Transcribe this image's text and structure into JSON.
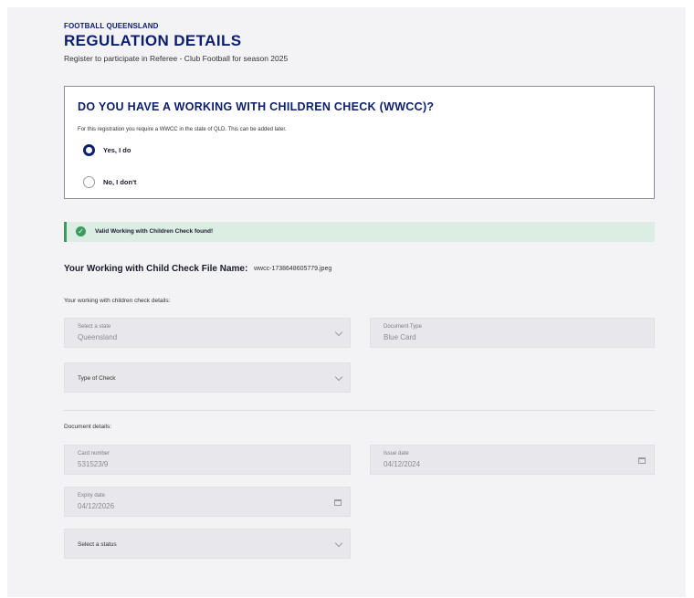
{
  "header": {
    "org": "FOOTBALL QUEENSLAND",
    "title": "REGULATION DETAILS",
    "subtitle": "Register to participate in Referee - Club Football for season 2025"
  },
  "wwcc_question": {
    "title": "DO YOU HAVE A WORKING WITH CHILDREN CHECK (WWCC)?",
    "description": "For this registration you require a WWCC in the state of QLD. This can be added later.",
    "options": [
      {
        "label": "Yes, I do",
        "selected": true
      },
      {
        "label": "No, I don't",
        "selected": false
      }
    ]
  },
  "banner": {
    "message": "Valid Working with Children Check found!",
    "color": "#3d9a5e"
  },
  "file": {
    "label": "Your Working with Child Check File Name:",
    "name": "wwcc-1738648605779.jpeg"
  },
  "wwcc_details": {
    "section_label": "Your working with children check details:",
    "state": {
      "label": "Select a state",
      "value": "Queensland"
    },
    "document_type": {
      "label": "Document Type",
      "value": "Blue Card"
    },
    "type_of_check": {
      "placeholder": "Type of Check"
    }
  },
  "document_details": {
    "section_label": "Document details:",
    "card_number": {
      "label": "Card number",
      "value": "531523/9"
    },
    "issue_date": {
      "label": "Issue date",
      "value": "04/12/2024"
    },
    "expiry_date": {
      "label": "Expiry date",
      "value": "04/12/2026"
    },
    "status": {
      "placeholder": "Select a status"
    }
  },
  "icons": {
    "chevron": "chevron-down-icon",
    "calendar": "calendar-icon",
    "check": "check-circle-icon"
  },
  "colors": {
    "brand": "#0c1e6e",
    "success_bg": "#dceee3",
    "field_bg": "#e8e8ec"
  }
}
